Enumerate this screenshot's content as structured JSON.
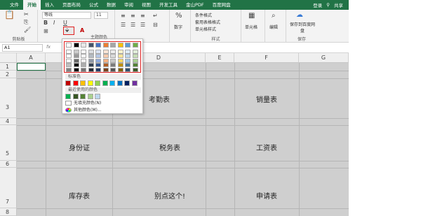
{
  "menu": {
    "items": [
      "文件",
      "开始",
      "插入",
      "页面布局",
      "公式",
      "数据",
      "审阅",
      "视图",
      "开发工具",
      "金山PDF",
      "百度网盘"
    ],
    "active_index": 1,
    "login": "登录",
    "share": "共享"
  },
  "ribbon": {
    "clipboard_label": "剪贴板",
    "font_name": "等线",
    "font_size": "11",
    "bold": "B",
    "italic": "I",
    "underline": "U",
    "number_label": "数字",
    "number_icon": "%",
    "style_items": [
      "条件格式",
      "套用表格格式",
      "单元格样式"
    ],
    "style_label": "样式",
    "cells_label": "单元格",
    "edit_label": "编辑",
    "save_button": "保存到百度网盘",
    "save_label": "保存"
  },
  "formula_bar": {
    "namebox": "A1",
    "fx": "fx"
  },
  "grid": {
    "columns": [
      "A",
      "B",
      "C",
      "D",
      "E",
      "F",
      "G"
    ],
    "rows": [
      "1",
      "2",
      "3",
      "4",
      "5",
      "6",
      "7",
      "8"
    ],
    "cells": {
      "d3": "考勤表",
      "f3": "销量表",
      "b5": "身份证",
      "d5": "税务表",
      "f5": "工资表",
      "b7": "库存表",
      "d7": "别点这个!",
      "f7": "申请表"
    }
  },
  "color_menu": {
    "theme_label": "主题颜色",
    "standard_label": "标准色",
    "recent_label": "最近使用的颜色",
    "no_fill": "无填充颜色(N)",
    "more_colors": "其他颜色(M)..."
  },
  "colors": {
    "theme_columns": [
      "#ffffff",
      "#000000",
      "#e7e6e6",
      "#44546a",
      "#4472c4",
      "#ed7d31",
      "#a5a5a5",
      "#ffc000",
      "#5b9bd5",
      "#70ad47"
    ],
    "standard": [
      "#c00000",
      "#ff0000",
      "#ffc000",
      "#ffff00",
      "#92d050",
      "#00b050",
      "#00b0f0",
      "#0070c0",
      "#002060",
      "#7030a0"
    ],
    "recent": [
      "#00b050",
      "#375623",
      "#548235",
      "#a9d08e",
      "#bdd7ee"
    ],
    "accent_green": "#217346"
  }
}
